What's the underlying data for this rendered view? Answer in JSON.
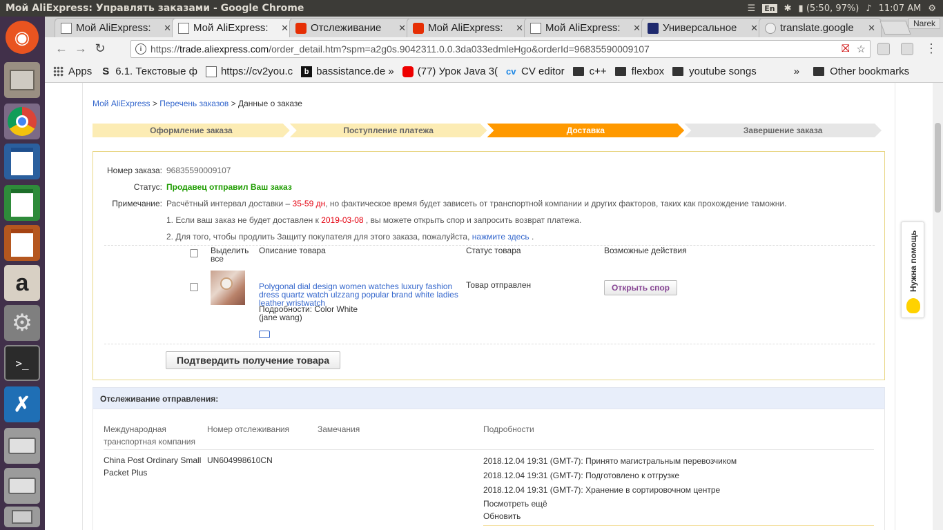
{
  "os": {
    "window_title": "Мой AliExpress: Управлять заказами - Google Chrome",
    "lang": "En",
    "battery": "(5:50, 97%)",
    "time": "11:07 AM",
    "user": "Narek"
  },
  "tabs": [
    {
      "title": "Мой AliExpress:",
      "favicon": "page-icon",
      "active": false
    },
    {
      "title": "Мой AliExpress:",
      "favicon": "page-icon",
      "active": true
    },
    {
      "title": "Отслеживание",
      "favicon": "aliexpress-icon",
      "active": false
    },
    {
      "title": "Мой AliExpress:",
      "favicon": "aliexpress-icon",
      "active": false
    },
    {
      "title": "Мой AliExpress:",
      "favicon": "page-icon",
      "active": false
    },
    {
      "title": "Универсальное",
      "favicon": "track17-icon",
      "active": false
    },
    {
      "title": "translate.google",
      "favicon": "translate-icon",
      "active": false
    }
  ],
  "url": {
    "scheme": "https://",
    "domain": "trade.aliexpress.com",
    "path": "/order_detail.htm?spm=a2g0s.9042311.0.0.3da033edmleHgo&orderId=96835590009107"
  },
  "bookmarks": [
    {
      "label": "Apps",
      "icon": "apps-grid-icon"
    },
    {
      "label": "6.1. Текстовые ф",
      "icon": "stepik-icon"
    },
    {
      "label": "https://cv2you.c",
      "icon": "page-icon"
    },
    {
      "label": "bassistance.de »",
      "icon": "bassistance-icon"
    },
    {
      "label": "(77) Урок Java 3(",
      "icon": "youtube-icon"
    },
    {
      "label": "CV editor",
      "icon": "cv-icon"
    },
    {
      "label": "c++",
      "icon": "folder-icon"
    },
    {
      "label": "flexbox",
      "icon": "folder-icon"
    },
    {
      "label": "youtube songs",
      "icon": "folder-icon"
    }
  ],
  "bookmarks_more": "»",
  "other_bookmarks": "Other bookmarks",
  "breadcrumb": {
    "item1": "Мой AliExpress",
    "sep": " > ",
    "item2": "Перечень заказов",
    "item3": "Данные о заказе"
  },
  "steps": [
    {
      "label": "Оформление заказа",
      "state": "done"
    },
    {
      "label": "Поступление платежа",
      "state": "done"
    },
    {
      "label": "Доставка",
      "state": "current"
    },
    {
      "label": "Завершение заказа",
      "state": "todo"
    }
  ],
  "order": {
    "number_label": "Номер заказа:",
    "number": "96835590009107",
    "status_label": "Статус:",
    "status": "Продавец отправил Ваш заказ",
    "note_label": "Примечание:",
    "note_pre": "Расчётный интервал доставки –",
    "note_days": "35-59 дн",
    "note_post": ", но фактическое время будет зависеть от транспортной компании и других факторов, таких как прохождение таможни.",
    "note1_pre": "1. Если ваш заказ не будет доставлен к",
    "note1_date": "2019-03-08",
    "note1_post": ", вы можете открыть спор и запросить возврат платежа.",
    "note2_pre": "2. Для того, чтобы продлить Защиту покупателя для этого заказа, пожалуйста,",
    "note2_link": "нажмите здесь",
    "note2_post": "."
  },
  "table": {
    "select_all": "Выделить все",
    "col_desc": "Описание товара",
    "col_status": "Статус товара",
    "col_actions": "Возможные действия"
  },
  "product": {
    "name": "Polygonal dial design women watches luxury fashion dress quartz watch ulzzang popular brand white ladies leather wristwatch",
    "details": "Подробности: Color White",
    "seller": "(jane wang)",
    "status": "Товар отправлен",
    "dispute_button": "Открыть спор"
  },
  "confirm_button": "Подтвердить получение товара",
  "tracking": {
    "header": "Отслеживание отправления:",
    "col_company": "Международная транспортная компания",
    "col_number": "Номер отслеживания",
    "col_remarks": "Замечания",
    "col_details": "Подробности",
    "company": "China Post Ordinary Small Packet Plus",
    "number": "UN604998610CN",
    "events": [
      "2018.12.04 19:31 (GMT-7): Принято магистральным перевозчиком",
      "2018.12.04 19:31 (GMT-7): Подготовлено к отгрузке",
      "2018.12.04 19:31 (GMT-7): Хранение в сортировочном центре"
    ],
    "more": "Посмотреть ещё",
    "refresh": "Обновить"
  },
  "help_widget": "Нужна помощь",
  "colors": {
    "accent_orange": "#ff9900",
    "status_green": "#1e9c00",
    "warning_red": "#e4000f",
    "link_blue": "#3366cc"
  }
}
